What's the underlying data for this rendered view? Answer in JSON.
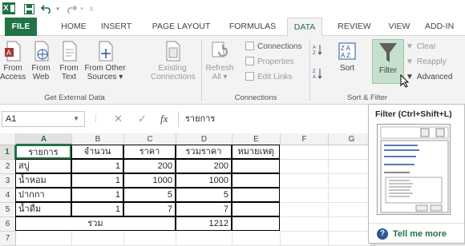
{
  "app": {
    "logo_text": "X",
    "icons": {
      "save": "save-icon",
      "undo": "undo-icon",
      "redo": "redo-icon",
      "customize": "customize-qat-icon"
    }
  },
  "tabs": [
    "FILE",
    "HOME",
    "INSERT",
    "PAGE LAYOUT",
    "FORMULAS",
    "DATA",
    "REVIEW",
    "VIEW",
    "ADD-IN"
  ],
  "active_tab": "DATA",
  "ribbon": {
    "get_external_data": {
      "label": "Get External Data",
      "buttons": [
        {
          "line1": "From",
          "line2": "Access"
        },
        {
          "line1": "From",
          "line2": "Web"
        },
        {
          "line1": "From",
          "line2": "Text"
        },
        {
          "line1": "From Other",
          "line2": "Sources ▾"
        }
      ],
      "existing": {
        "line1": "Existing",
        "line2": "Connections"
      }
    },
    "connections": {
      "label": "Connections",
      "refresh": {
        "line1": "Refresh",
        "line2": "All ▾"
      },
      "items": [
        "Connections",
        "Properties",
        "Edit Links"
      ]
    },
    "sort_filter": {
      "label": "Sort & Filter",
      "sort": "Sort",
      "filter": "Filter",
      "clear": "Clear",
      "reapply": "Reapply",
      "advanced": "Advanced"
    }
  },
  "formula_bar": {
    "name_box": "A1",
    "cancel": "✕",
    "enter": "✓",
    "fx": "fx",
    "value": "รายการ"
  },
  "columns": [
    "A",
    "B",
    "C",
    "D",
    "E",
    "F",
    "G"
  ],
  "selected_column": "A",
  "rows": [
    {
      "num": "1",
      "cells": [
        "รายการ",
        "จำนวน",
        "ราคา",
        "รวมราคา",
        "หมายเหตุ",
        "",
        ""
      ]
    },
    {
      "num": "2",
      "cells": [
        "สบู่",
        "1",
        "200",
        "200",
        "",
        "",
        ""
      ]
    },
    {
      "num": "3",
      "cells": [
        "น้ำหอม",
        "1",
        "1000",
        "1000",
        "",
        "",
        ""
      ]
    },
    {
      "num": "4",
      "cells": [
        "ปากกา",
        "1",
        "5",
        "5",
        "",
        "",
        ""
      ]
    },
    {
      "num": "5",
      "cells": [
        "น้ำดื่ม",
        "1",
        "7",
        "7",
        "",
        "",
        ""
      ]
    },
    {
      "num": "6",
      "cells": [
        "รวม",
        "",
        "",
        "1212",
        "",
        "",
        ""
      ]
    },
    {
      "num": "7",
      "cells": [
        "",
        "",
        "",
        "",
        "",
        "",
        ""
      ]
    }
  ],
  "tooltip": {
    "title": "Filter (Ctrl+Shift+L)",
    "more": "Tell me more"
  }
}
